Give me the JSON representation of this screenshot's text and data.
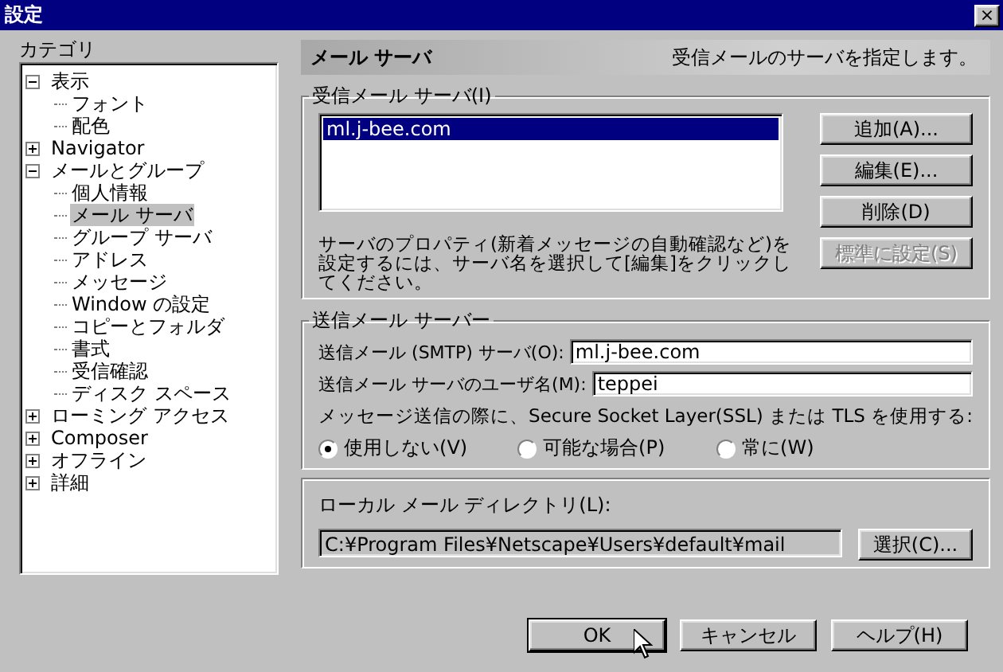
{
  "window": {
    "title": "設定",
    "close_label": "×"
  },
  "category_label": "カテゴリ",
  "tree": [
    {
      "label": "表示",
      "expanded": true,
      "selected": false,
      "children": [
        {
          "label": "フォント",
          "selected": false
        },
        {
          "label": "配色",
          "selected": false
        }
      ]
    },
    {
      "label": "Navigator",
      "expanded": false,
      "selected": false
    },
    {
      "label": "メールとグループ",
      "expanded": true,
      "selected": false,
      "children": [
        {
          "label": "個人情報",
          "selected": false
        },
        {
          "label": "メール サーバ",
          "selected": true
        },
        {
          "label": "グループ サーバ",
          "selected": false
        },
        {
          "label": "アドレス",
          "selected": false
        },
        {
          "label": "メッセージ",
          "selected": false
        },
        {
          "label": "Window の設定",
          "selected": false
        },
        {
          "label": "コピーとフォルダ",
          "selected": false
        },
        {
          "label": "書式",
          "selected": false
        },
        {
          "label": "受信確認",
          "selected": false
        },
        {
          "label": "ディスク スペース",
          "selected": false
        }
      ]
    },
    {
      "label": "ローミング アクセス",
      "expanded": false,
      "selected": false
    },
    {
      "label": "Composer",
      "expanded": false,
      "selected": false
    },
    {
      "label": "オフライン",
      "expanded": false,
      "selected": false
    },
    {
      "label": "詳細",
      "expanded": false,
      "selected": false
    }
  ],
  "header": {
    "title": "メール サーバ",
    "description": "受信メールのサーバを指定します。"
  },
  "incoming": {
    "legend": "受信メール サーバ(I)",
    "servers": [
      {
        "name": "ml.j-bee.com",
        "selected": true
      }
    ],
    "note": "サーバのプロパティ(新着メッセージの自動確認など)を設定するには、サーバ名を選択して[編集]をクリックしてください。",
    "buttons": [
      {
        "label": "追加(A)...",
        "disabled": false
      },
      {
        "label": "編集(E)...",
        "disabled": false
      },
      {
        "label": "削除(D)",
        "disabled": false
      },
      {
        "label": "標準に設定(S)",
        "disabled": true
      }
    ]
  },
  "outgoing": {
    "legend": "送信メール サーバー",
    "fields": [
      {
        "label": "送信メール (SMTP) サーバ(O):",
        "value": "ml.j-bee.com"
      },
      {
        "label": "送信メール サーバのユーザ名(M):",
        "value": "teppei"
      }
    ],
    "ssl_label": "メッセージ送信の際に、Secure Socket Layer(SSL) または TLS を使用する:",
    "ssl_options": [
      {
        "label": "使用しない(V)",
        "selected": true
      },
      {
        "label": "可能な場合(P)",
        "selected": false
      },
      {
        "label": "常に(W)",
        "selected": false
      }
    ]
  },
  "local": {
    "label": "ローカル メール ディレクトリ(L):",
    "path": "C:¥Program Files¥Netscape¥Users¥default¥mail",
    "button": "選択(C)..."
  },
  "buttons": [
    {
      "label": "OK",
      "default": true
    },
    {
      "label": "キャンセル",
      "default": false
    },
    {
      "label": "ヘルプ(H)",
      "default": false
    }
  ]
}
